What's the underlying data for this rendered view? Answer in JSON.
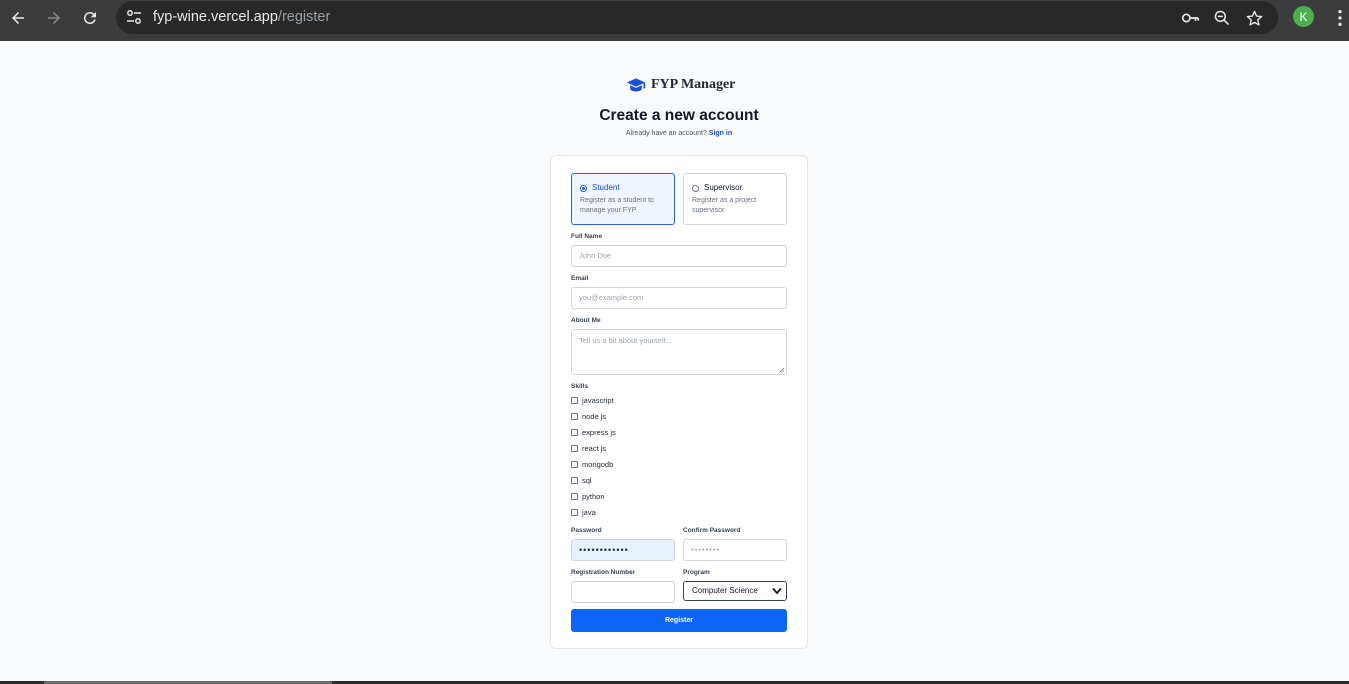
{
  "browser": {
    "url_host": "fyp-wine.vercel.app",
    "url_path": "/register",
    "profile_initial": "K",
    "icons": [
      "back-arrow-icon",
      "forward-arrow-icon",
      "reload-icon",
      "site-settings-icon",
      "password-key-icon",
      "zoom-icon",
      "bookmark-star-icon",
      "more-menu-icon"
    ]
  },
  "brand": {
    "name": "FYP Manager",
    "icon": "graduation-cap-icon"
  },
  "header": {
    "title": "Create a new account",
    "subtitle_text": "Already have an account?",
    "signin_link": "Sign in"
  },
  "roles": [
    {
      "title": "Student",
      "description": "Register as a student to manage your FYP",
      "selected": true
    },
    {
      "title": "Supervisor",
      "description": "Register as a project supervisor",
      "selected": false
    }
  ],
  "form": {
    "full_name": {
      "label": "Full Name",
      "placeholder": "John Doe"
    },
    "email": {
      "label": "Email",
      "placeholder": "you@example.com"
    },
    "about": {
      "label": "About Me",
      "placeholder": "Tell us a bit about yourself..."
    },
    "skills_label": "Skills",
    "skills": [
      "javascript",
      "node js",
      "express js",
      "react js",
      "mongodb",
      "sql",
      "python",
      "java"
    ],
    "password": {
      "label": "Password",
      "value": "••••••••••••"
    },
    "confirm_password": {
      "label": "Confirm Password",
      "placeholder": "••••••••"
    },
    "registration_number": {
      "label": "Registration Number",
      "value": ""
    },
    "program": {
      "label": "Program",
      "selected": "Computer Science"
    },
    "submit_label": "Register"
  },
  "colors": {
    "primary": "#0b66f5",
    "page_bg": "#f8fafc",
    "chrome_bg": "#3c3c3c"
  }
}
